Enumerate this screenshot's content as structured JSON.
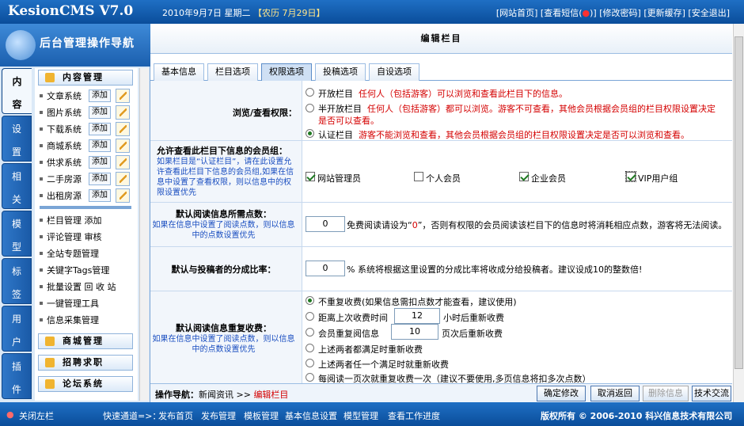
{
  "app": {
    "logo": "KesionCMS V7.0"
  },
  "top": {
    "date": "2010年9月7日 星期二",
    "lunar": "【农历 7月29日】",
    "links": [
      "[网站首页]",
      "[查看短信(",
      ")]",
      "[修改密码]",
      "[更新缓存]",
      "[安全退出]"
    ]
  },
  "nav": {
    "title": "后台管理操作导航",
    "vtabs": [
      [
        "内",
        "容"
      ],
      [
        "设",
        "置"
      ],
      [
        "相",
        "关"
      ],
      [
        "模",
        "型"
      ],
      [
        "标",
        "签"
      ],
      [
        "用",
        "户"
      ],
      [
        "插",
        "件"
      ]
    ],
    "sections": {
      "content": "内容管理",
      "mall": "商城管理",
      "jobs": "招聘求职",
      "forum": "论坛系统"
    },
    "systems": [
      "文章系统",
      "图片系统",
      "下载系统",
      "商城系统",
      "供求系统",
      "二手房源",
      "出租房源"
    ],
    "add_label": "添加",
    "links": [
      "栏目管理",
      "评论管理",
      "全站专题管理",
      "关键字Tags管理",
      "批量设置",
      "一键管理工具",
      "信息采集管理"
    ],
    "link_extras": {
      "add": "添加",
      "review": "审核",
      "recycle": "回 收 站"
    },
    "close_left": "关闭左栏"
  },
  "page": {
    "title": "编辑栏目"
  },
  "tabs": [
    "基本信息",
    "栏目选项",
    "权限选项",
    "投稿选项",
    "自设选项"
  ],
  "active_tab": 2,
  "permission": {
    "label": "浏览/查看权限：",
    "options": [
      {
        "name": "开放栏目",
        "desc": "任何人（包括游客）可以浏览和查看此栏目下的信息。"
      },
      {
        "name": "半开放栏目",
        "desc": "任何人（包括游客）都可以浏览。游客不可查看，其他会员根据会员组的栏目权限设置决定是否可以查看。"
      },
      {
        "name": "认证栏目",
        "desc": "游客不能浏览和查看，其他会员根据会员组的栏目权限设置决定是否可以浏览和查看。"
      }
    ],
    "selected": 2
  },
  "groups": {
    "label": "允许查看此栏目下信息的会员组：",
    "hint": "如果栏目是“认证栏目”，请在此设置允许查看此栏目下信息的会员组,如果在信息中设置了查看权限，则以信息中的权限设置优先",
    "items": [
      "网站管理员",
      "个人会员",
      "企业会员",
      "VIP用户组"
    ],
    "checked": [
      true,
      false,
      true,
      true
    ]
  },
  "points": {
    "label": "默认阅读信息所需点数：",
    "hint": "如果在信息中设置了阅读点数，则以信息中的点数设置优先",
    "value": "0",
    "desc_pre": "免费阅读请设为“",
    "desc_zero": "0",
    "desc_post": "”，否则有权限的会员阅读该栏目下的信息时将消耗相应点数，游客将无法阅读。"
  },
  "share": {
    "label": "默认与投稿者的分成比率：",
    "value": "0",
    "desc": "% 系统将根据这里设置的分成比率将收成分给投稿者。建议设成10的整数倍!"
  },
  "charge": {
    "label": "默认阅读信息重复收费：",
    "hint": "如果在信息中设置了阅读点数，则以信息中的点数设置优先",
    "options": [
      "不重复收费(如果信息需扣点数才能查看，建议使用)",
      "距离上次收费时间",
      "会员重复阅信息",
      "上述两者都满足时重新收费",
      "上述两者任一个满足时就重新收费",
      "每阅读一页次就重复收费一次（建议不要使用,多页信息将扣多次点数）"
    ],
    "hours_value": "12",
    "hours_suffix": "小时后重新收费",
    "times_value": "10",
    "times_suffix": "页次后重新收费",
    "selected": 0
  },
  "bottom": {
    "crumb_label": "操作导航：",
    "crumb_path": "新闻资讯",
    "crumb_sep": ">>",
    "crumb_current": "编辑栏目",
    "buttons": [
      "确定修改",
      "取消返回",
      "删除信息",
      "技术交流"
    ]
  },
  "status": {
    "quick_label": "快速通道=>：",
    "quick_links": [
      "发布首页",
      "发布管理",
      "模板管理",
      "基本信息设置",
      "模型管理",
      "查看工作进度"
    ],
    "copyright": "版权所有 © 2006-2010 科兴信息技术有限公司"
  },
  "colors": {
    "header_blue": "#0a4d9a",
    "hint_blue": "#1a4ec0",
    "warning_red": "#d40000"
  }
}
